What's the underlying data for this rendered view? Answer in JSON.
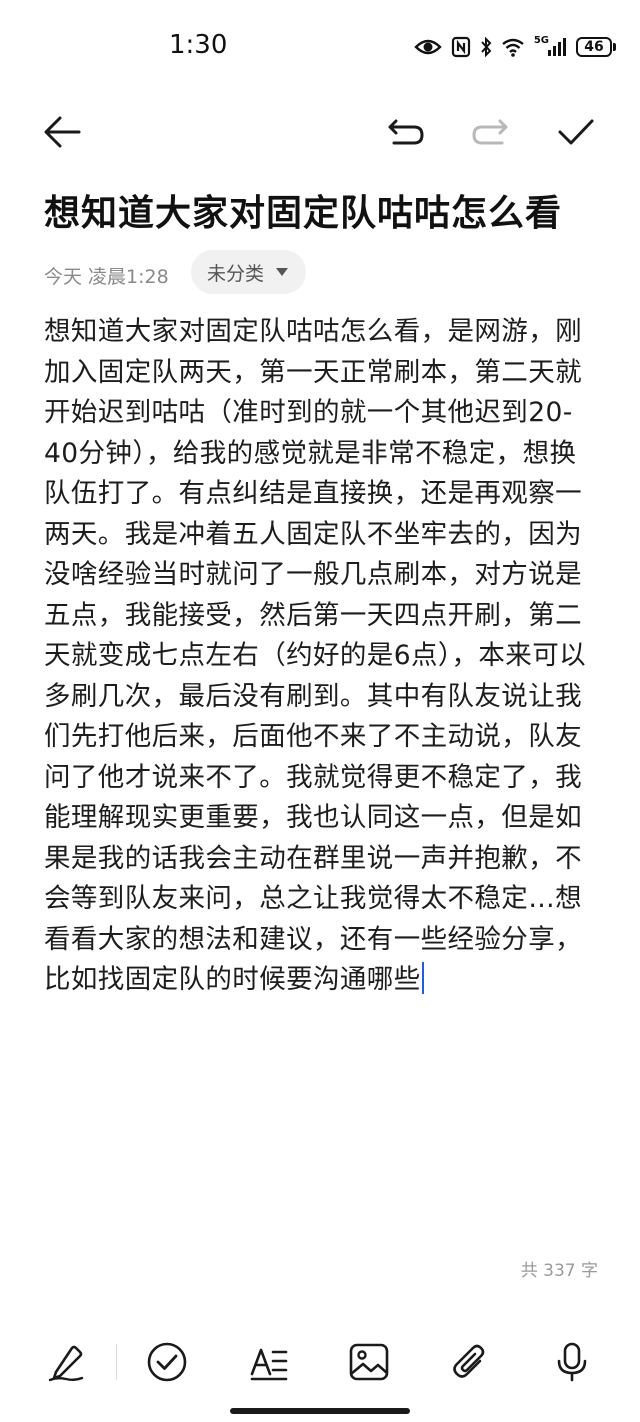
{
  "status_bar": {
    "time": "1:30",
    "network": "5G",
    "battery": "46",
    "icons": [
      "eye-icon",
      "nfc-icon",
      "bluetooth-icon",
      "wifi-icon",
      "signal-icon",
      "battery-icon"
    ]
  },
  "toolbar": {
    "back_icon": "arrow-left-icon",
    "undo_icon": "undo-icon",
    "redo_icon": "redo-icon",
    "done_icon": "check-icon"
  },
  "note": {
    "title": "想知道大家对固定队咕咕怎么看",
    "timestamp": "今天 凌晨1:28",
    "category": "未分类",
    "body": "想知道大家对固定队咕咕怎么看，是网游，刚加入固定队两天，第一天正常刷本，第二天就开始迟到咕咕（准时到的就一个其他迟到20-40分钟），给我的感觉就是非常不稳定，想换队伍打了。有点纠结是直接换，还是再观察一两天。我是冲着五人固定队不坐牢去的，因为没啥经验当时就问了一般几点刷本，对方说是五点，我能接受，然后第一天四点开刷，第二天就变成七点左右（约好的是6点），本来可以多刷几次，最后没有刷到。其中有队友说让我们先打他后来，后面他不来了不主动说，队友问了他才说来不了。我就觉得更不稳定了，我能理解现实更重要，我也认同这一点，但是如果是我的话我会主动在群里说一声并抱歉，不会等到队友来问，总之让我觉得太不稳定…想看看大家的想法和建议，还有一些经验分享，比如找固定队的时候要沟通哪些",
    "word_count": "共 337 字"
  },
  "bottom_toolbar": {
    "icons": [
      "pen-icon",
      "checklist-icon",
      "text-format-icon",
      "image-icon",
      "attachment-icon",
      "microphone-icon"
    ]
  },
  "colors": {
    "cursor": "#1f5fd6",
    "chip_bg": "#f1f1f1",
    "meta_text": "#8a8a8a"
  }
}
